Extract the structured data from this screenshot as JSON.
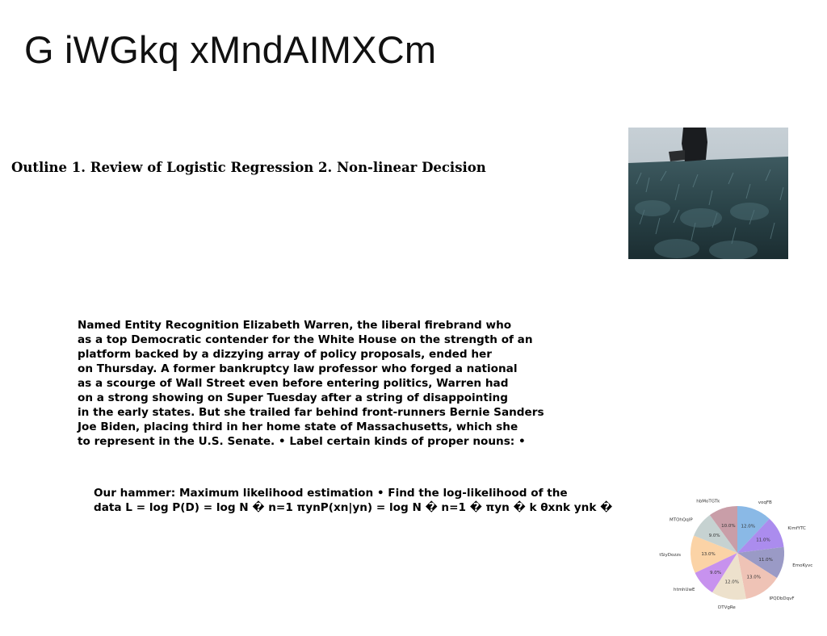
{
  "title": "G iWGkq xMndAIMXCm",
  "outline": "Outline 1. Review of Logistic Regression 2. Non-linear Decision",
  "ner_lines": [
    "Named Entity Recognition Elizabeth Warren, the liberal firebrand who",
    "as a top Democratic contender for the White House on the strength of an",
    "platform backed by a dizzying array of policy proposals, ended her",
    "on Thursday. A former bankruptcy law professor who forged a national",
    "as a scourge of Wall Street even before entering politics, Warren had",
    "on a strong showing on Super Tuesday after a string of disappointing",
    "in the early states. But she trailed far behind front-runners Bernie Sanders",
    "Joe Biden, placing third in her home state of Massachusetts, which she",
    "to represent in the U.S. Senate. • Label certain kinds of proper nouns: •"
  ],
  "mle_lines": [
    "Our hammer: Maximum likelihood estimation • Find the log-likelihood of the",
    "data L = log P(D) = log N � n=1 πynP(xn|yn) = log N � n=1 � πyn � k θxnk ynk �"
  ],
  "chart_data": {
    "type": "pie",
    "categories": [
      "voqFB",
      "KimfYTC",
      "EmoKyvc",
      "IPQDbDqvF",
      "DTVgRe",
      "htmhUwE",
      "tSiyDozzs",
      "MTOhQqIP",
      "hbMoTGTk"
    ],
    "values": [
      12.0,
      11.0,
      11.0,
      13.0,
      12.0,
      9.0,
      13.0,
      9.0,
      10.0
    ],
    "labels": [
      "12.0%",
      "11.0%",
      "11.0%",
      "13.0%",
      "12.0%",
      "9.0%",
      "13.0%",
      "9.0%",
      "10.0%"
    ],
    "colors": [
      "#8ab9e6",
      "#ab8cee",
      "#9a9ac6",
      "#efc3b6",
      "#ede1cc",
      "#c792ee",
      "#fbd3a6",
      "#c6d2d1",
      "#c99ea8"
    ]
  }
}
